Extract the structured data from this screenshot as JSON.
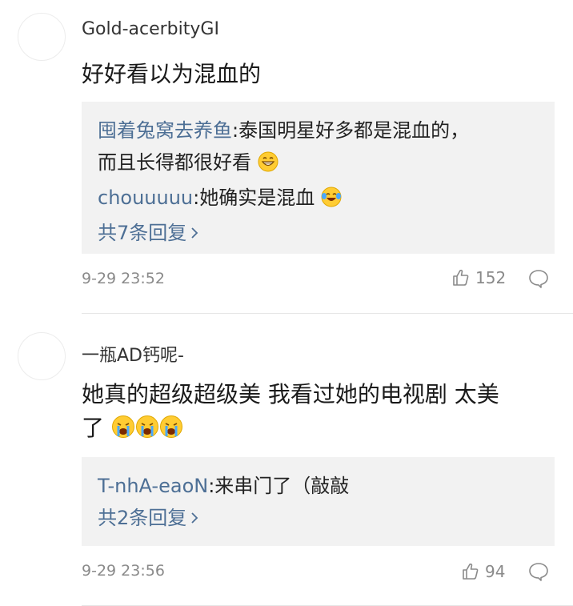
{
  "comments": [
    {
      "username": "Gold-acerbityGI",
      "content": "好好看以为混血的",
      "replies": [
        {
          "author": "囤着兔窝去养鱼",
          "text": ":泰国明星好多都是混血的，",
          "text_line2": "而且长得都很好看"
        },
        {
          "author": "chouuuuu",
          "text": ":她确实是混血"
        }
      ],
      "more_replies": "共7条回复",
      "timestamp": "9-29 23:52",
      "likes": "152"
    },
    {
      "username": "一瓶AD钙呢-",
      "content_line1": "她真的超级超级美 我看过她的电视剧 太美",
      "content_line2": "了",
      "replies": [
        {
          "author": "T-nhA-eaoN",
          "text": ":来串门了（敲敲"
        }
      ],
      "more_replies": "共2条回复",
      "timestamp": "9-29 23:56",
      "likes": "94"
    }
  ],
  "icons": {
    "grin": "grinning-emoji",
    "laugh_cry": "tears-of-joy-emoji",
    "crying": "loudly-crying-emoji",
    "like": "thumbs-up-icon",
    "reply": "comment-bubble-icon",
    "more": "chevron-right-icon"
  },
  "colors": {
    "link": "#4d6f95",
    "meta": "#8a8a8a",
    "reply_bg": "#f2f2f2"
  }
}
